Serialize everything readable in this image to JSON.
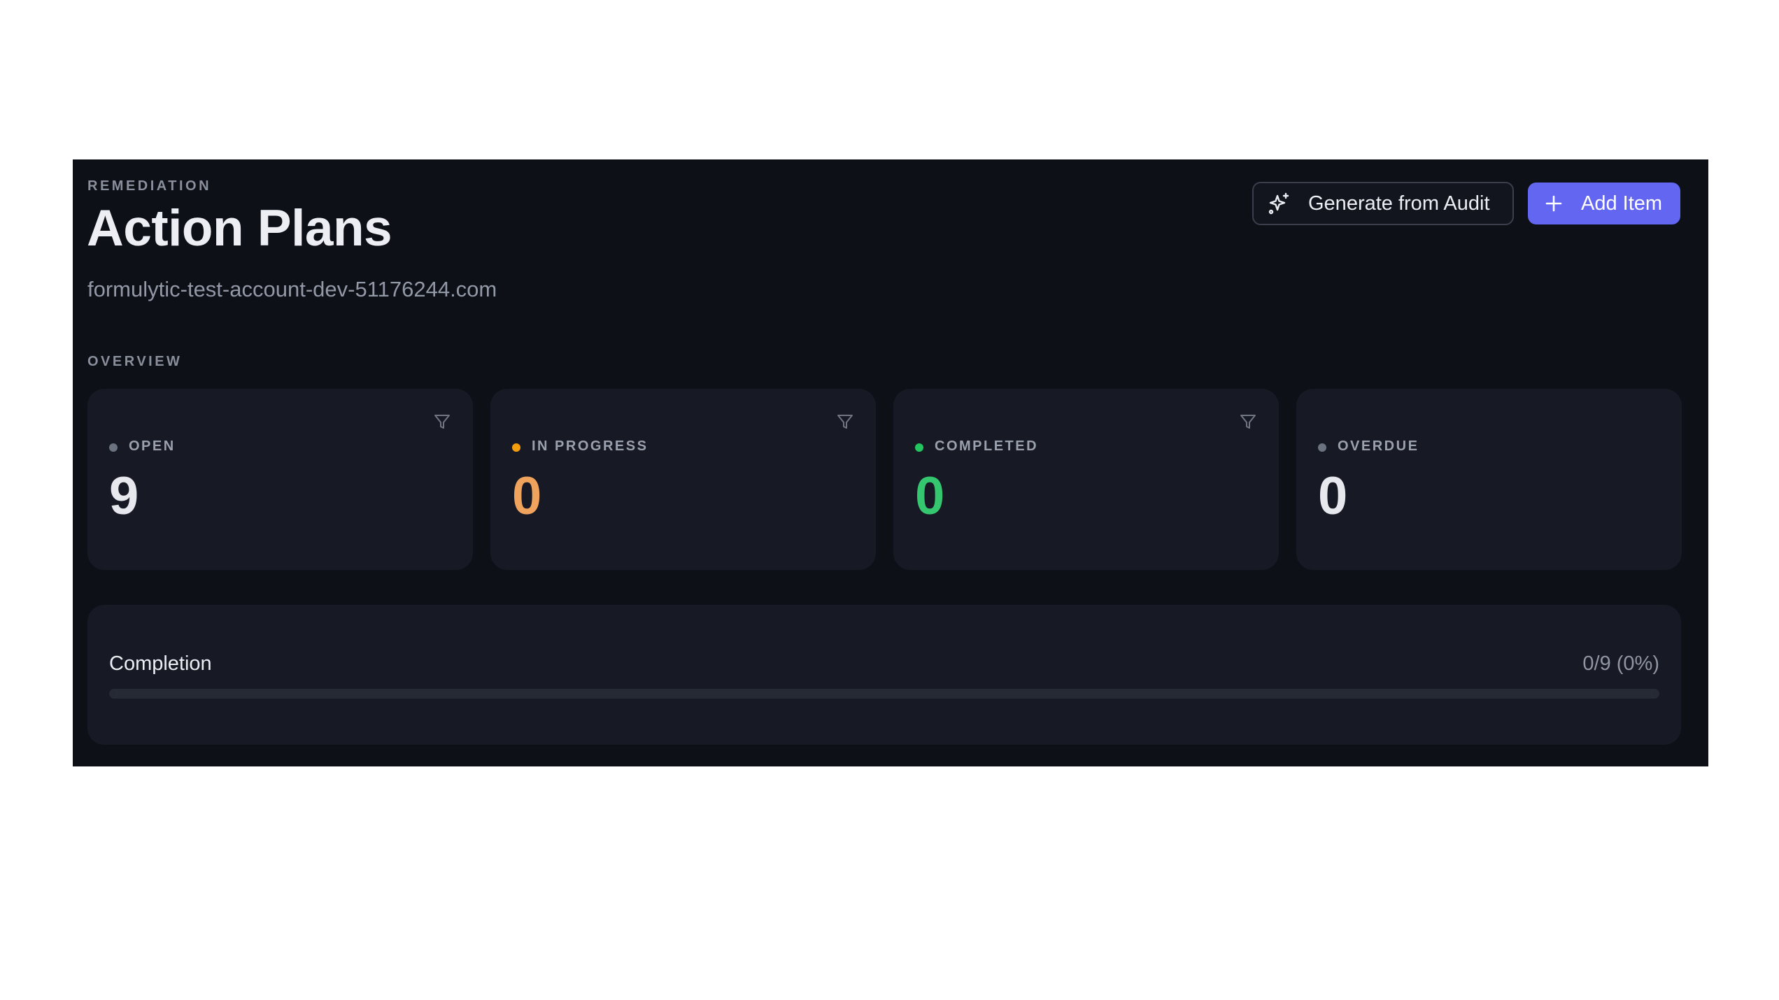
{
  "header": {
    "eyebrow": "REMEDIATION",
    "title": "Action Plans",
    "subtitle": "formulytic-test-account-dev-51176244.com"
  },
  "actions": {
    "generate_label": "Generate from Audit",
    "generate_icon": "sparkles-icon",
    "add_label": "Add Item",
    "add_icon": "plus-icon"
  },
  "overview": {
    "label": "OVERVIEW",
    "cards": [
      {
        "label": "OPEN",
        "value": "9",
        "dot_color": "#6b7280",
        "value_color": "#e6e8ee",
        "filter_icon": "filter-icon"
      },
      {
        "label": "IN PROGRESS",
        "value": "0",
        "dot_color": "#f59e0b",
        "value_color": "#f0a35c",
        "filter_icon": "filter-icon"
      },
      {
        "label": "COMPLETED",
        "value": "0",
        "dot_color": "#22c55e",
        "value_color": "#34c76f",
        "filter_icon": "filter-icon"
      },
      {
        "label": "OVERDUE",
        "value": "0",
        "dot_color": "#6b7280",
        "value_color": "#e6e8ee"
      }
    ]
  },
  "completion": {
    "label": "Completion",
    "value_text": "0/9 (0%)",
    "progress_fraction": 0
  },
  "colors": {
    "background": "#0d1017",
    "card": "#171a24",
    "accent": "#6366f1"
  }
}
